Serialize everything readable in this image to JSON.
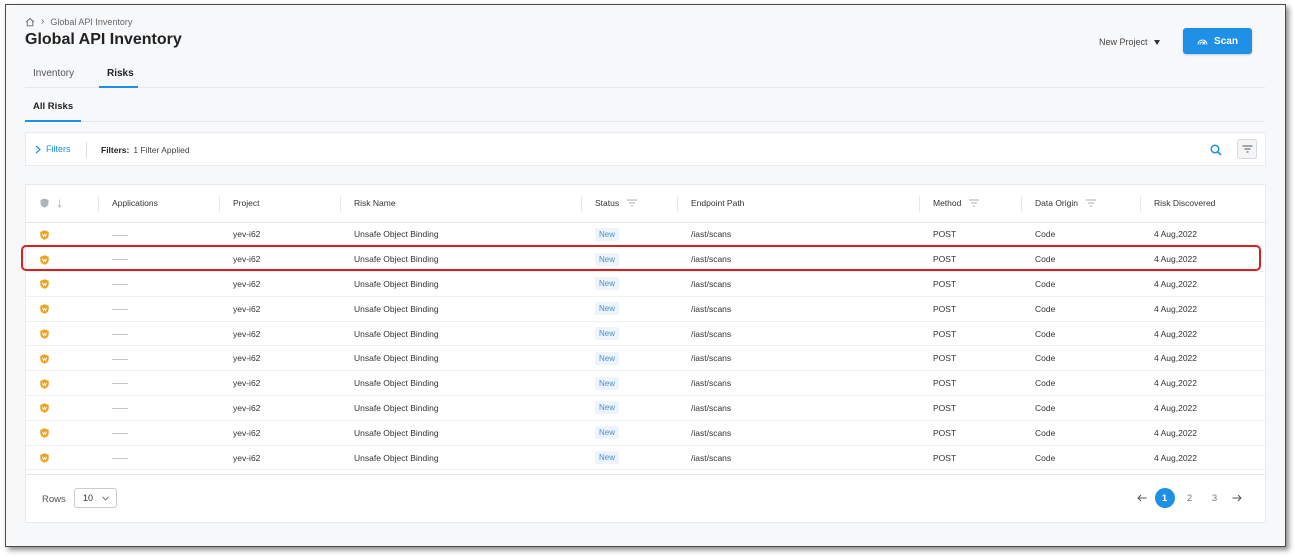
{
  "breadcrumb": {
    "current": "Global API Inventory"
  },
  "page_title": "Global API Inventory",
  "project_select": {
    "label": "New Project"
  },
  "scan_button": {
    "label": "Scan"
  },
  "tabs": [
    {
      "label": "Inventory",
      "active": false
    },
    {
      "label": "Risks",
      "active": true
    }
  ],
  "subtabs": [
    {
      "label": "All Risks",
      "active": true
    }
  ],
  "filter_bar": {
    "toggle_label": "Filters",
    "applied_label": "Filters:",
    "applied_value": "1 Filter Applied"
  },
  "table": {
    "columns": [
      "Applications",
      "Project",
      "Risk Name",
      "Status",
      "Endpoint Path",
      "Method",
      "Data Origin",
      "Risk Discovered"
    ],
    "rows": [
      {
        "application": "",
        "project": "yev-i62",
        "risk_name": "Unsafe Object Binding",
        "status": "New",
        "endpoint": "/iast/scans",
        "method": "POST",
        "origin": "Code",
        "discovered": "4 Aug,2022"
      },
      {
        "application": "",
        "project": "yev-i62",
        "risk_name": "Unsafe Object Binding",
        "status": "New",
        "endpoint": "/iast/scans",
        "method": "POST",
        "origin": "Code",
        "discovered": "4 Aug,2022"
      },
      {
        "application": "",
        "project": "yev-i62",
        "risk_name": "Unsafe Object Binding",
        "status": "New",
        "endpoint": "/iast/scans",
        "method": "POST",
        "origin": "Code",
        "discovered": "4 Aug,2022"
      },
      {
        "application": "",
        "project": "yev-i62",
        "risk_name": "Unsafe Object Binding",
        "status": "New",
        "endpoint": "/iast/scans",
        "method": "POST",
        "origin": "Code",
        "discovered": "4 Aug,2022"
      },
      {
        "application": "",
        "project": "yev-i62",
        "risk_name": "Unsafe Object Binding",
        "status": "New",
        "endpoint": "/iast/scans",
        "method": "POST",
        "origin": "Code",
        "discovered": "4 Aug,2022"
      },
      {
        "application": "",
        "project": "yev-i62",
        "risk_name": "Unsafe Object Binding",
        "status": "New",
        "endpoint": "/iast/scans",
        "method": "POST",
        "origin": "Code",
        "discovered": "4 Aug,2022"
      },
      {
        "application": "",
        "project": "yev-i62",
        "risk_name": "Unsafe Object Binding",
        "status": "New",
        "endpoint": "/iast/scans",
        "method": "POST",
        "origin": "Code",
        "discovered": "4 Aug,2022"
      },
      {
        "application": "",
        "project": "yev-i62",
        "risk_name": "Unsafe Object Binding",
        "status": "New",
        "endpoint": "/iast/scans",
        "method": "POST",
        "origin": "Code",
        "discovered": "4 Aug,2022"
      },
      {
        "application": "",
        "project": "yev-i62",
        "risk_name": "Unsafe Object Binding",
        "status": "New",
        "endpoint": "/iast/scans",
        "method": "POST",
        "origin": "Code",
        "discovered": "4 Aug,2022"
      },
      {
        "application": "",
        "project": "yev-i62",
        "risk_name": "Unsafe Object Binding",
        "status": "New",
        "endpoint": "/iast/scans",
        "method": "POST",
        "origin": "Code",
        "discovered": "4 Aug,2022"
      }
    ]
  },
  "pagination": {
    "rows_label": "Rows",
    "rows_value": "10",
    "pages": [
      "1",
      "2",
      "3"
    ],
    "current_page": "1"
  },
  "colors": {
    "accent": "#1e90e6",
    "risk_icon": "#f0a020",
    "highlight": "#d8201f"
  },
  "icons": {
    "home": "home-icon",
    "scan": "radar-icon",
    "search": "search-icon",
    "filter": "filter-icon",
    "risk": "shield-warning-icon"
  }
}
